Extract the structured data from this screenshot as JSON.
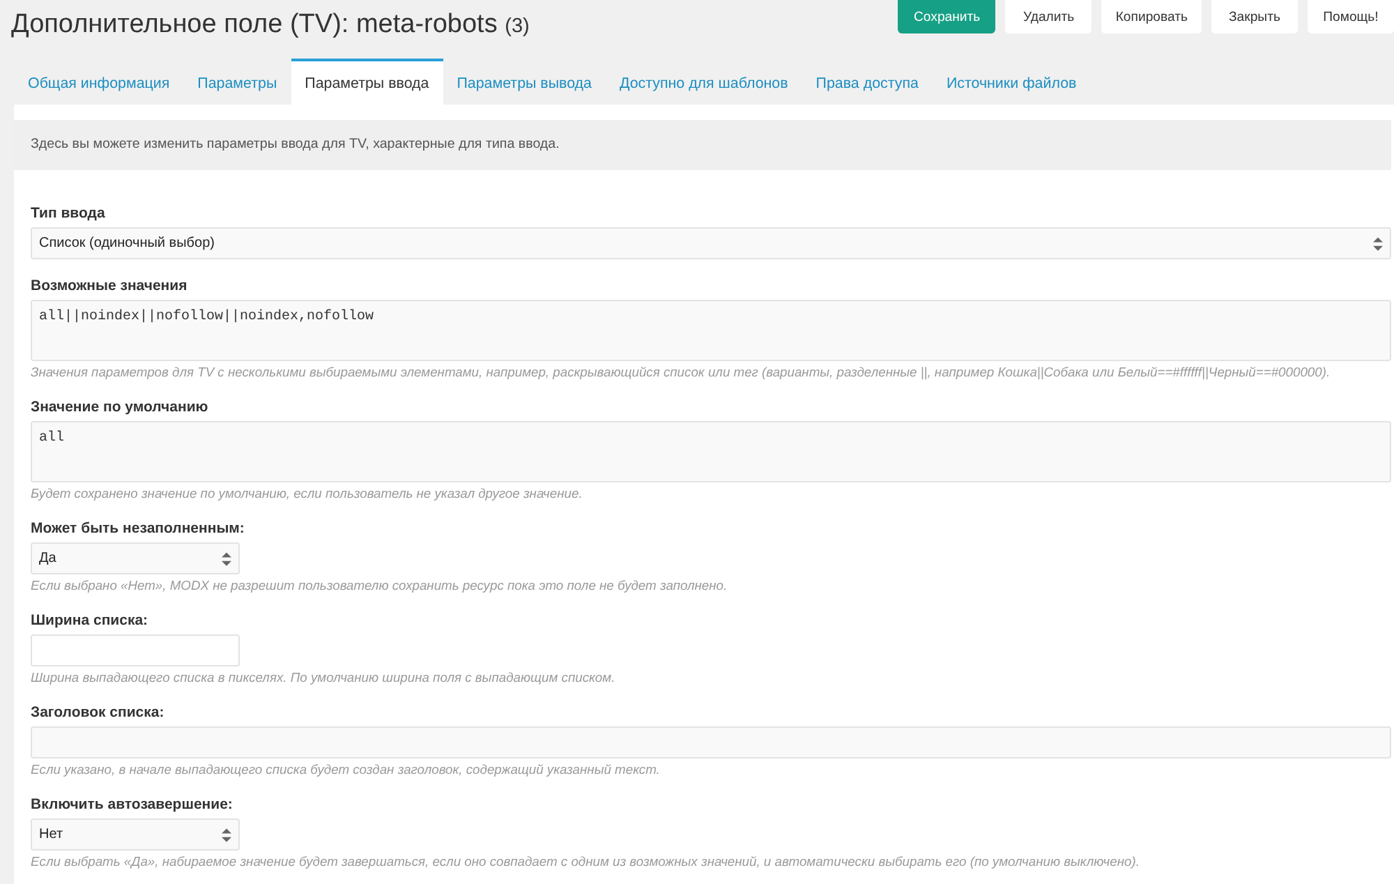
{
  "header": {
    "title": "Дополнительное поле (TV): meta-robots",
    "count": "(3)"
  },
  "buttons": [
    {
      "label": "Сохранить",
      "kind": "save"
    },
    {
      "label": "Удалить",
      "kind": "delete"
    },
    {
      "label": "Копировать",
      "kind": "copy"
    },
    {
      "label": "Закрыть",
      "kind": "close"
    },
    {
      "label": "Помощь!",
      "kind": "help"
    }
  ],
  "tabs": [
    {
      "label": "Общая информация",
      "selected": false
    },
    {
      "label": "Параметры",
      "selected": false
    },
    {
      "label": "Параметры ввода",
      "selected": true
    },
    {
      "label": "Параметры вывода",
      "selected": false
    },
    {
      "label": "Доступно для шаблонов",
      "selected": false
    },
    {
      "label": "Права доступа",
      "selected": false
    },
    {
      "label": "Источники файлов",
      "selected": false
    }
  ],
  "info": "Здесь вы можете изменить параметры ввода для TV, характерные для типа ввода.",
  "sections": [
    {
      "fields": [
        {
          "label": "Тип ввода",
          "kind": "select",
          "value": "Список (одиночный выбор)"
        },
        {
          "label": "Возможные значения",
          "kind": "textarea",
          "value": "all||noindex||nofollow||noindex,nofollow",
          "hint": "Значения параметров для TV с несколькими выбираемыми элементами, например, раскрывающийся список или тег (варианты, разделенные ||, например Кошка||Собака или Белый==#ffffff||Черный==#000000)."
        },
        {
          "label": "Значение по умолчанию",
          "kind": "textarea",
          "value": "all",
          "hint": "Будет сохранено значение по умолчанию, если пользователь не указал другое значение."
        }
      ]
    },
    {
      "fields": [
        {
          "label": "Может быть незаполненным:",
          "kind": "boolean",
          "value": "Да",
          "hint": "Если выбрано «Нет», MODX не разрешит пользователю сохранить ресурс пока это поле не будет заполнено."
        },
        {
          "label": "Ширина списка:",
          "kind": "number",
          "hint": "Ширина выпадающего списка в пикселях. По умолчанию ширина поля с выпадающим списком."
        },
        {
          "label": "Заголовок списка:",
          "kind": "text",
          "hint": "Если указано, в начале выпадающего списка будет создан заголовок, содержащий указанный текст."
        },
        {
          "label": "Включить автозавершение:",
          "kind": "boolean",
          "value": "Нет",
          "hint": "Если выбрать «Да», набираемое значение будет завершаться, если оно совпадает с одним из возможных значений, и автоматически выбирать его (по умолчанию выключено)."
        }
      ]
    }
  ]
}
